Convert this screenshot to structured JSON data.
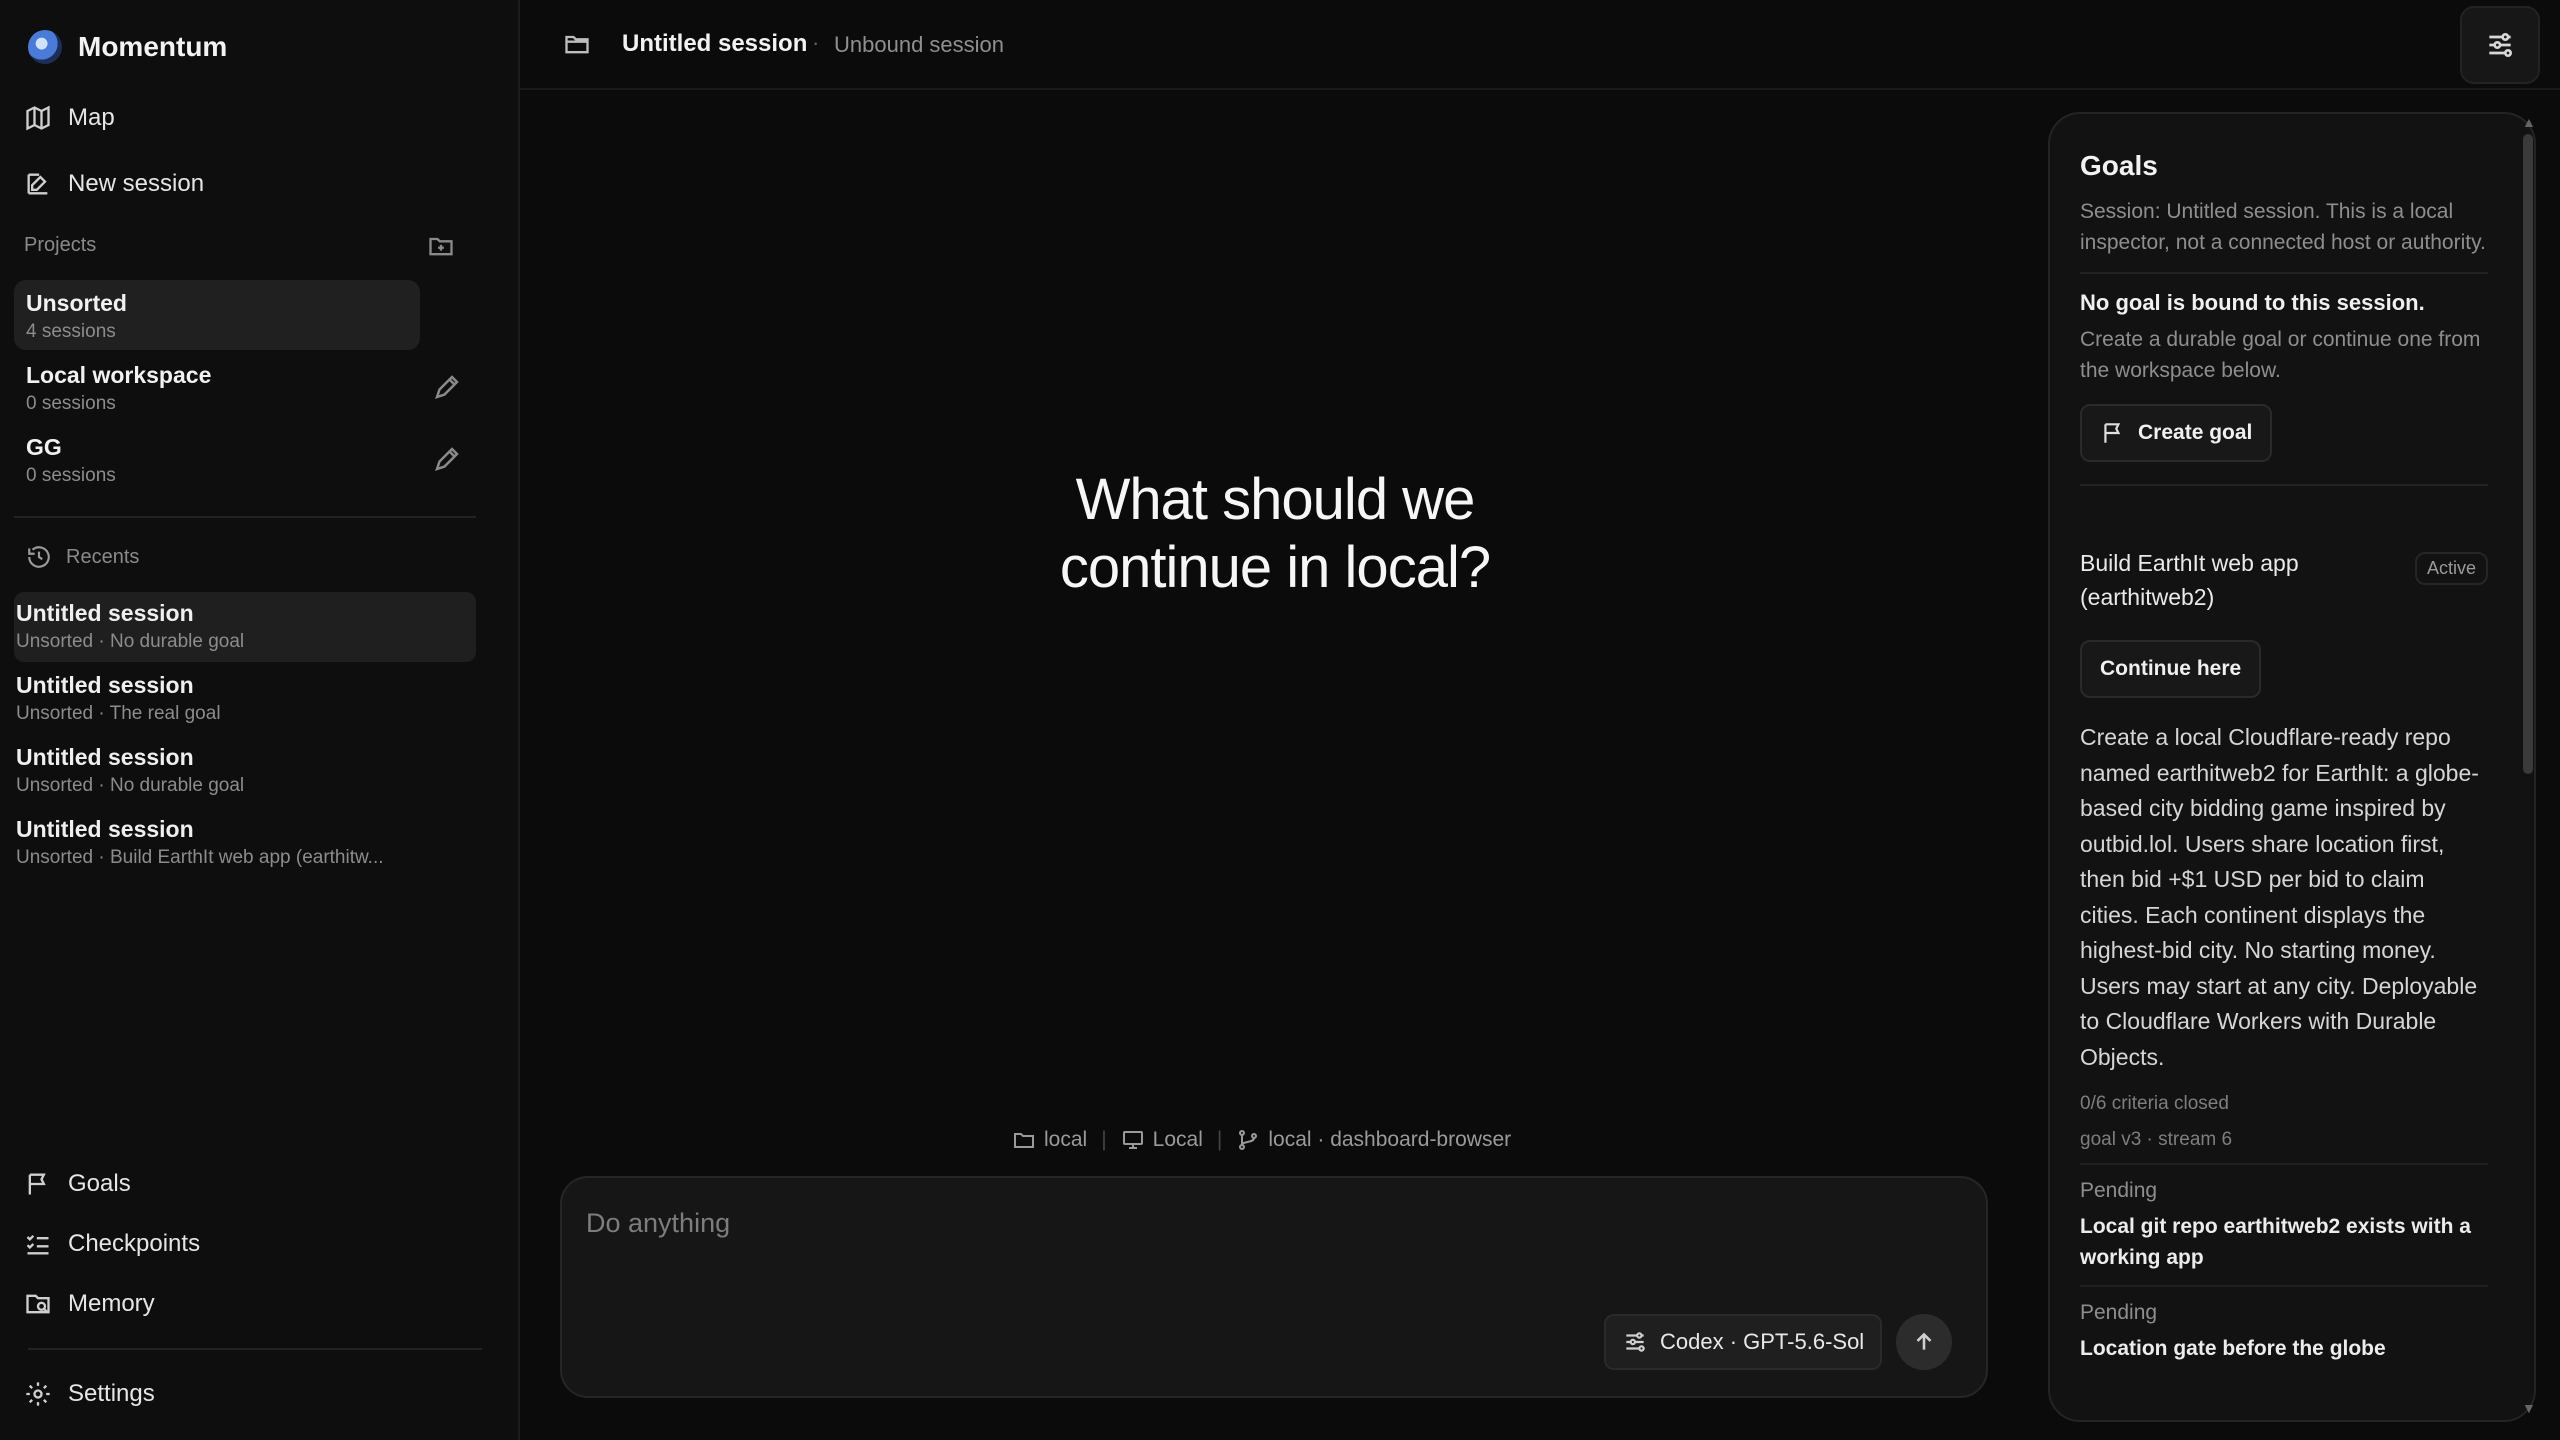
{
  "brand": {
    "name": "Momentum"
  },
  "nav_top": [
    {
      "label": "Map",
      "icon": "map-icon"
    },
    {
      "label": "New session",
      "icon": "edit-icon"
    }
  ],
  "projects": {
    "label": "Projects",
    "items": [
      {
        "name": "Unsorted",
        "sub": "4 sessions",
        "active": true
      },
      {
        "name": "Local workspace",
        "sub": "0 sessions"
      },
      {
        "name": "GG",
        "sub": "0 sessions"
      }
    ]
  },
  "recents": {
    "label": "Recents",
    "items": [
      {
        "title": "Untitled session",
        "sub": "Unsorted · No durable goal",
        "active": true
      },
      {
        "title": "Untitled session",
        "sub": "Unsorted · The real goal"
      },
      {
        "title": "Untitled session",
        "sub": "Unsorted · No durable goal"
      },
      {
        "title": "Untitled session",
        "sub": "Unsorted · Build EarthIt web app (earthitw..."
      }
    ]
  },
  "nav_bottom": [
    {
      "label": "Goals",
      "icon": "flag-icon"
    },
    {
      "label": "Checkpoints",
      "icon": "checklist-icon"
    },
    {
      "label": "Memory",
      "icon": "memory-icon"
    }
  ],
  "settings": {
    "label": "Settings"
  },
  "header": {
    "title": "Untitled session",
    "separator": "·",
    "subtitle": "Unbound session"
  },
  "hero": {
    "line1": "What should we",
    "line2": "continue in local?"
  },
  "context": {
    "folder": "local",
    "host": "Local",
    "branch": "local · dashboard-browser"
  },
  "composer": {
    "placeholder": "Do anything",
    "model": "Codex · GPT-5.6-Sol"
  },
  "goals": {
    "title": "Goals",
    "session_desc": "Session: Untitled session. This is a local inspector, not a connected host or authority.",
    "no_goal_title": "No goal is bound to this session.",
    "no_goal_desc": "Create a durable goal or continue one from the workspace below.",
    "create_label": "Create goal",
    "goal": {
      "name": "Build EarthIt web app (earthitweb2)",
      "status": "Active",
      "continue_label": "Continue here",
      "description": "Create a local Cloudflare-ready repo named earthitweb2 for EarthIt: a globe-based city bidding game inspired by outbid.lol. Users share location first, then bid +$1 USD per bid to claim cities. Each continent displays the highest-bid city. No starting money. Users may start at any city. Deployable to Cloudflare Workers with Durable Objects.",
      "criteria": "0/6 criteria closed",
      "version": "goal v3 · stream 6",
      "items": [
        {
          "state": "Pending",
          "text": "Local git repo earthitweb2 exists with a working app"
        },
        {
          "state": "Pending",
          "text": "Location gate before the globe"
        }
      ]
    }
  }
}
